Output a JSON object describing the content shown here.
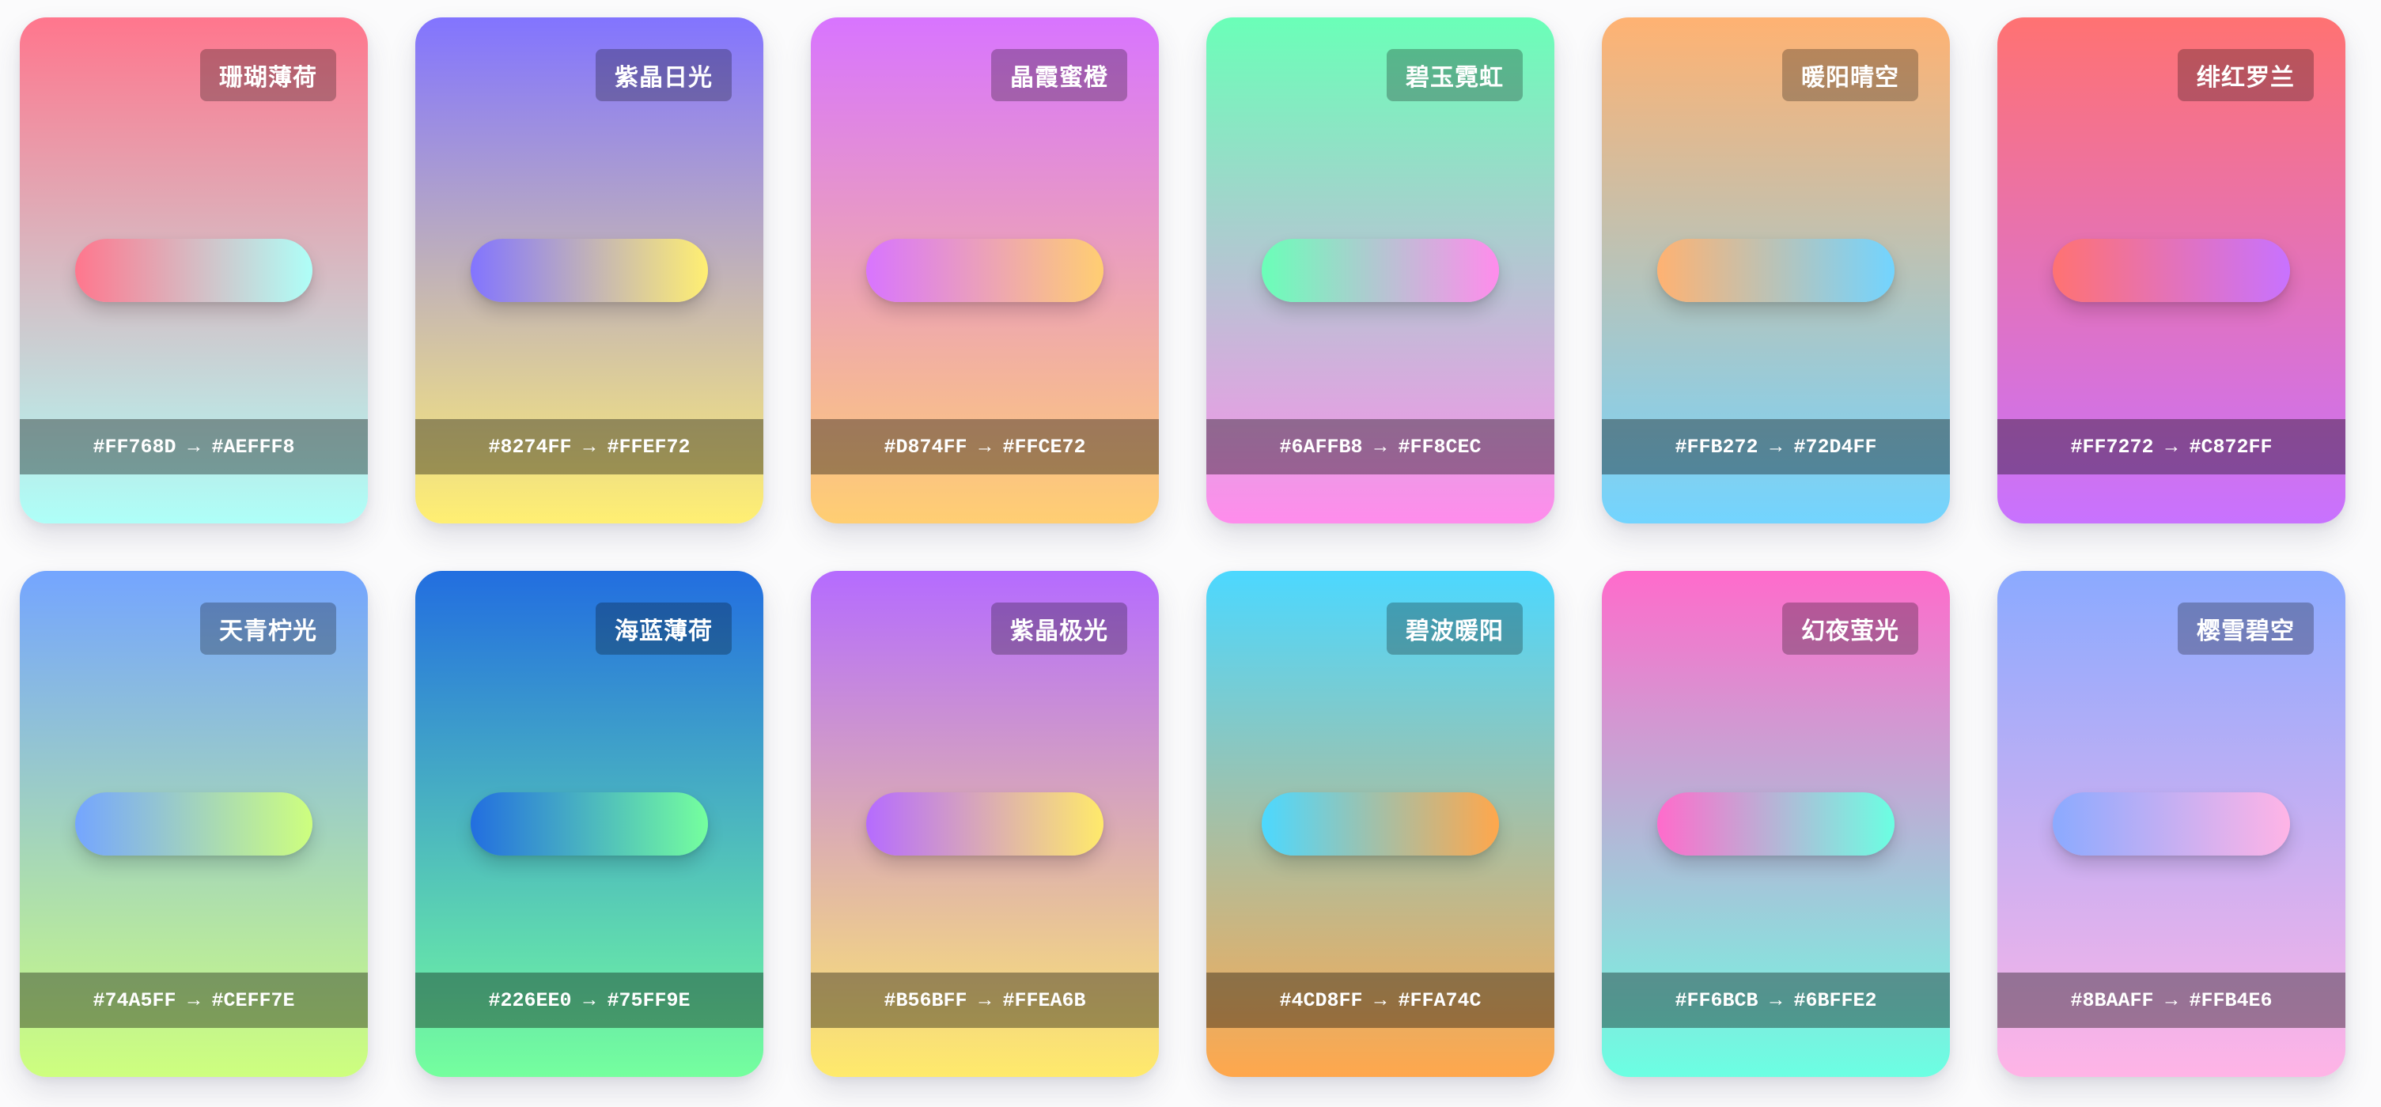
{
  "cards": [
    {
      "name": "珊瑚薄荷",
      "from": "#FF768D",
      "to": "#AEFFF8",
      "code": "#FF768D → #AEFFF8"
    },
    {
      "name": "紫晶日光",
      "from": "#8274FF",
      "to": "#FFEF72",
      "code": "#8274FF → #FFEF72"
    },
    {
      "name": "晶霞蜜橙",
      "from": "#D874FF",
      "to": "#FFCE72",
      "code": "#D874FF → #FFCE72"
    },
    {
      "name": "碧玉霓虹",
      "from": "#6AFFB8",
      "to": "#FF8CEC",
      "code": "#6AFFB8 → #FF8CEC"
    },
    {
      "name": "暖阳晴空",
      "from": "#FFB272",
      "to": "#72D4FF",
      "code": "#FFB272 → #72D4FF"
    },
    {
      "name": "绯红罗兰",
      "from": "#FF7272",
      "to": "#C872FF",
      "code": "#FF7272 → #C872FF"
    },
    {
      "name": "天青柠光",
      "from": "#74A5FF",
      "to": "#CEFF7E",
      "code": "#74A5FF → #CEFF7E"
    },
    {
      "name": "海蓝薄荷",
      "from": "#226EE0",
      "to": "#75FF9E",
      "code": "#226EE0 → #75FF9E"
    },
    {
      "name": "紫晶极光",
      "from": "#B56BFF",
      "to": "#FFEA6B",
      "code": "#B56BFF → #FFEA6B"
    },
    {
      "name": "碧波暖阳",
      "from": "#4CD8FF",
      "to": "#FFA74C",
      "code": "#4CD8FF → #FFA74C"
    },
    {
      "name": "幻夜萤光",
      "from": "#FF6BCB",
      "to": "#6BFFE2",
      "code": "#FF6BCB → #6BFFE2"
    },
    {
      "name": "樱雪碧空",
      "from": "#8BAAFF",
      "to": "#FFB4E6",
      "code": "#8BAAFF → #FFB4E6"
    }
  ]
}
